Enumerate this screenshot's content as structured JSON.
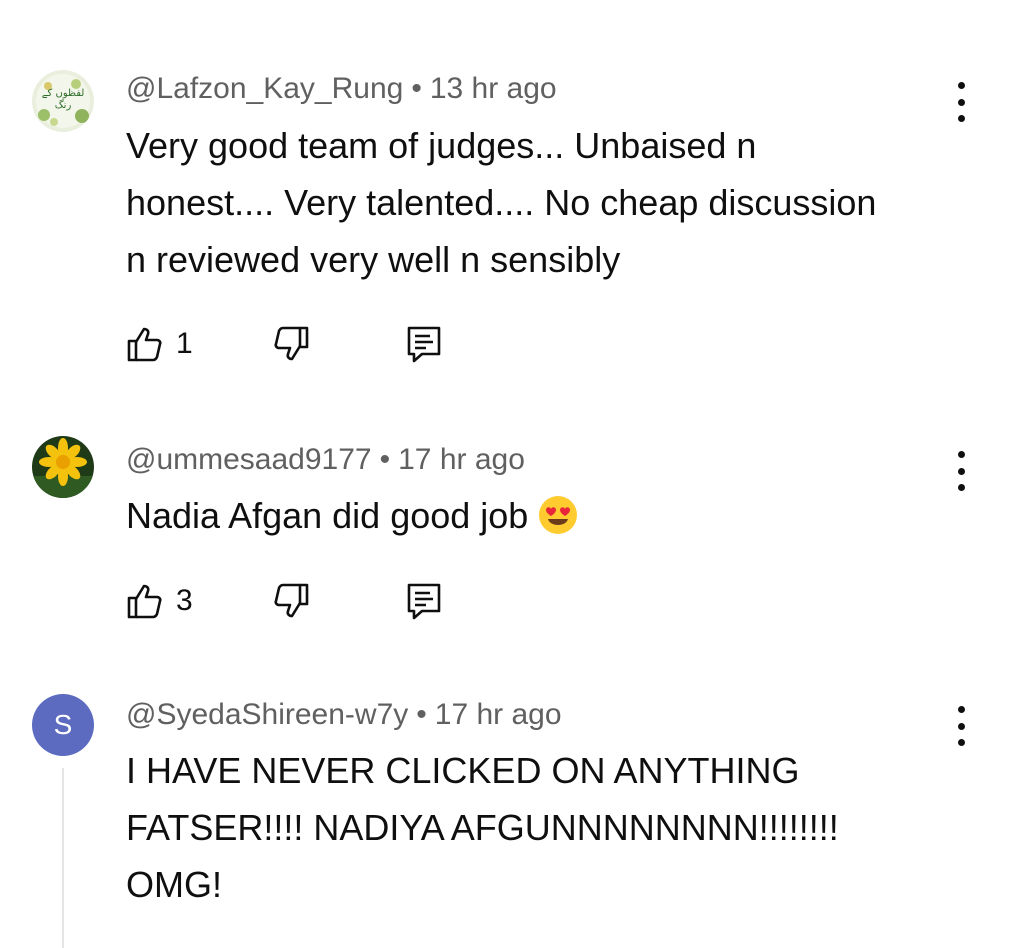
{
  "comments": [
    {
      "handle": "@Lafzon_Kay_Rung",
      "separator": "•",
      "time": "13 hr ago",
      "avatar_text": "لفظوں کے رنگ",
      "lines": [
        "Very good team of judges... Unbaised n",
        "honest.... Very talented.... No cheap discussion",
        "n reviewed very well n sensibly"
      ],
      "likes": "1"
    },
    {
      "handle": "@ummesaad9177",
      "separator": "•",
      "time": "17 hr ago",
      "lines": [
        "Nadia Afgan did good job"
      ],
      "emoji": "smiling-face-with-heart-eyes",
      "likes": "3"
    },
    {
      "handle": "@SyedaShireen-w7y",
      "separator": "•",
      "time": "17 hr ago",
      "avatar_letter": "S",
      "lines": [
        "I HAVE NEVER CLICKED ON ANYTHING",
        "FATSER!!!! NADIYA AFGUNNNNNNNN!!!!!!!!",
        "OMG!"
      ]
    }
  ],
  "colors": {
    "text": "#0f0f0f",
    "meta": "#606060",
    "avatar_letter_bg": "#5c6bc0",
    "thread_line": "#e5e5e5"
  },
  "icons": {
    "like": "thumb-up-icon",
    "dislike": "thumb-down-icon",
    "reply": "reply-icon",
    "more": "more-vertical-icon"
  }
}
